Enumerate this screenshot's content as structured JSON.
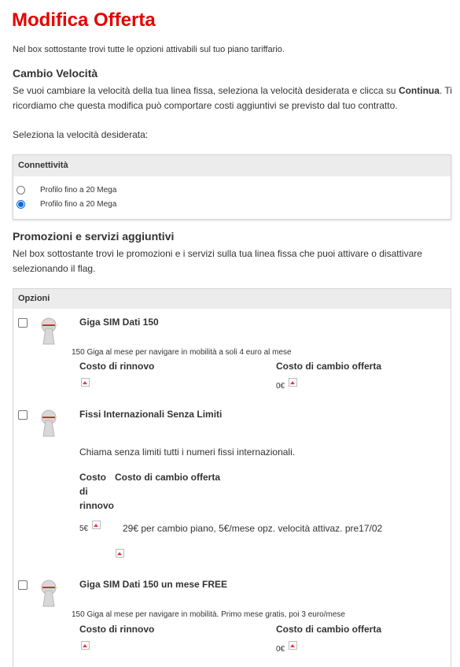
{
  "page": {
    "title": "Modifica Offerta"
  },
  "intro": "Nel box sottostante trovi tutte le opzioni attivabili sul tuo piano tariffario.",
  "speed": {
    "title": "Cambio Velocità",
    "text_before": "Se vuoi cambiare la velocità della tua linea fissa, seleziona la velocità desiderata e clicca su ",
    "text_bold": "Continua",
    "text_after": ". Ti ricordiamo che questa modifica può comportare costi aggiuntivi se previsto dal tuo contratto.",
    "select_label": "Seleziona la velocità desiderata:"
  },
  "connectivity": {
    "header": "Connettività",
    "options": [
      {
        "label": "Profilo fino a 20 Mega",
        "checked": false
      },
      {
        "label": "Profilo fino a 20 Mega",
        "checked": true
      }
    ]
  },
  "promos": {
    "title": "Promozioni e servizi aggiuntivi",
    "text": "Nel box sottostante trovi le promozioni e i servizi sulla tua linea fissa che puoi attivare o disattivare selezionando il flag."
  },
  "options": {
    "header": "Opzioni",
    "items": [
      {
        "title": "Giga SIM Dati 150",
        "description": "150 Giga al mese per navigare in mobilità a soli 4 euro al mese",
        "renewal_label": "Costo di rinnovo",
        "change_label": "Costo di cambio offerta",
        "change_value": "0€"
      },
      {
        "title": "Fissi Internazionali Senza Limiti",
        "description": "Chiama senza limiti tutti i numeri fissi internazionali.",
        "renewal_label_1": "Costo",
        "renewal_label_2": "di",
        "renewal_label_3": "rinnovo",
        "change_label": "Costo di cambio offerta",
        "renewal_value": "5€",
        "change_value": "29€ per cambio piano, 5€/mese opz. velocità attivaz. pre17/02"
      },
      {
        "title": "Giga SIM Dati 150 un mese FREE",
        "description": "150 Giga al mese per navigare in mobilità. Primo mese gratis, poi 3 euro/mese",
        "renewal_label": "Costo di rinnovo",
        "change_label": "Costo di cambio offerta",
        "change_value": "0€"
      }
    ]
  },
  "icons": {
    "keyhole": "keyhole-icon",
    "broken_image": "broken-image-icon"
  },
  "colors": {
    "brand": "#e60000",
    "radio_selected": "#0a6bd8"
  }
}
